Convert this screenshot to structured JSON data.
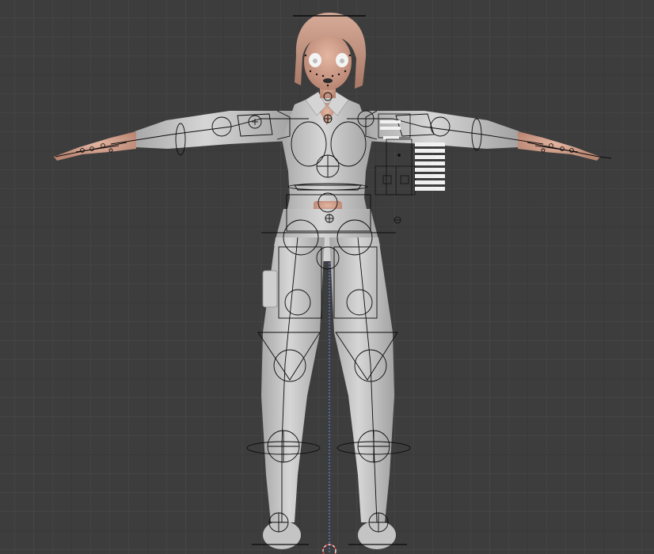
{
  "viewport": {
    "view": "front-orthographic",
    "colors": {
      "background": "#3d3d3d",
      "grid_minor": "#4a4a4a",
      "grid_major": "#353535",
      "axis_z": "#5a7ec8",
      "mesh_body": "#c9c9c9",
      "mesh_shade": "#9a9a9a",
      "skin": "#d3a18c",
      "hair": "#c89a86",
      "rig_wire": "#0a0a0a",
      "custom_panel": "#f2f2f2"
    },
    "icons": [
      "3d-cursor-icon"
    ]
  },
  "model": {
    "type": "t-pose-character",
    "hair_color": "#c89a86",
    "outfit_color": "#c9c9c9"
  },
  "rig_properties_panel": {
    "labels": [
      "IK/FK Arm",
      "Neck Follow",
      "Head Follow",
      "IK/FK Leg",
      "Arm Stretch",
      "Leg Stretch",
      "Pole Follow",
      "Spine Follow"
    ]
  }
}
